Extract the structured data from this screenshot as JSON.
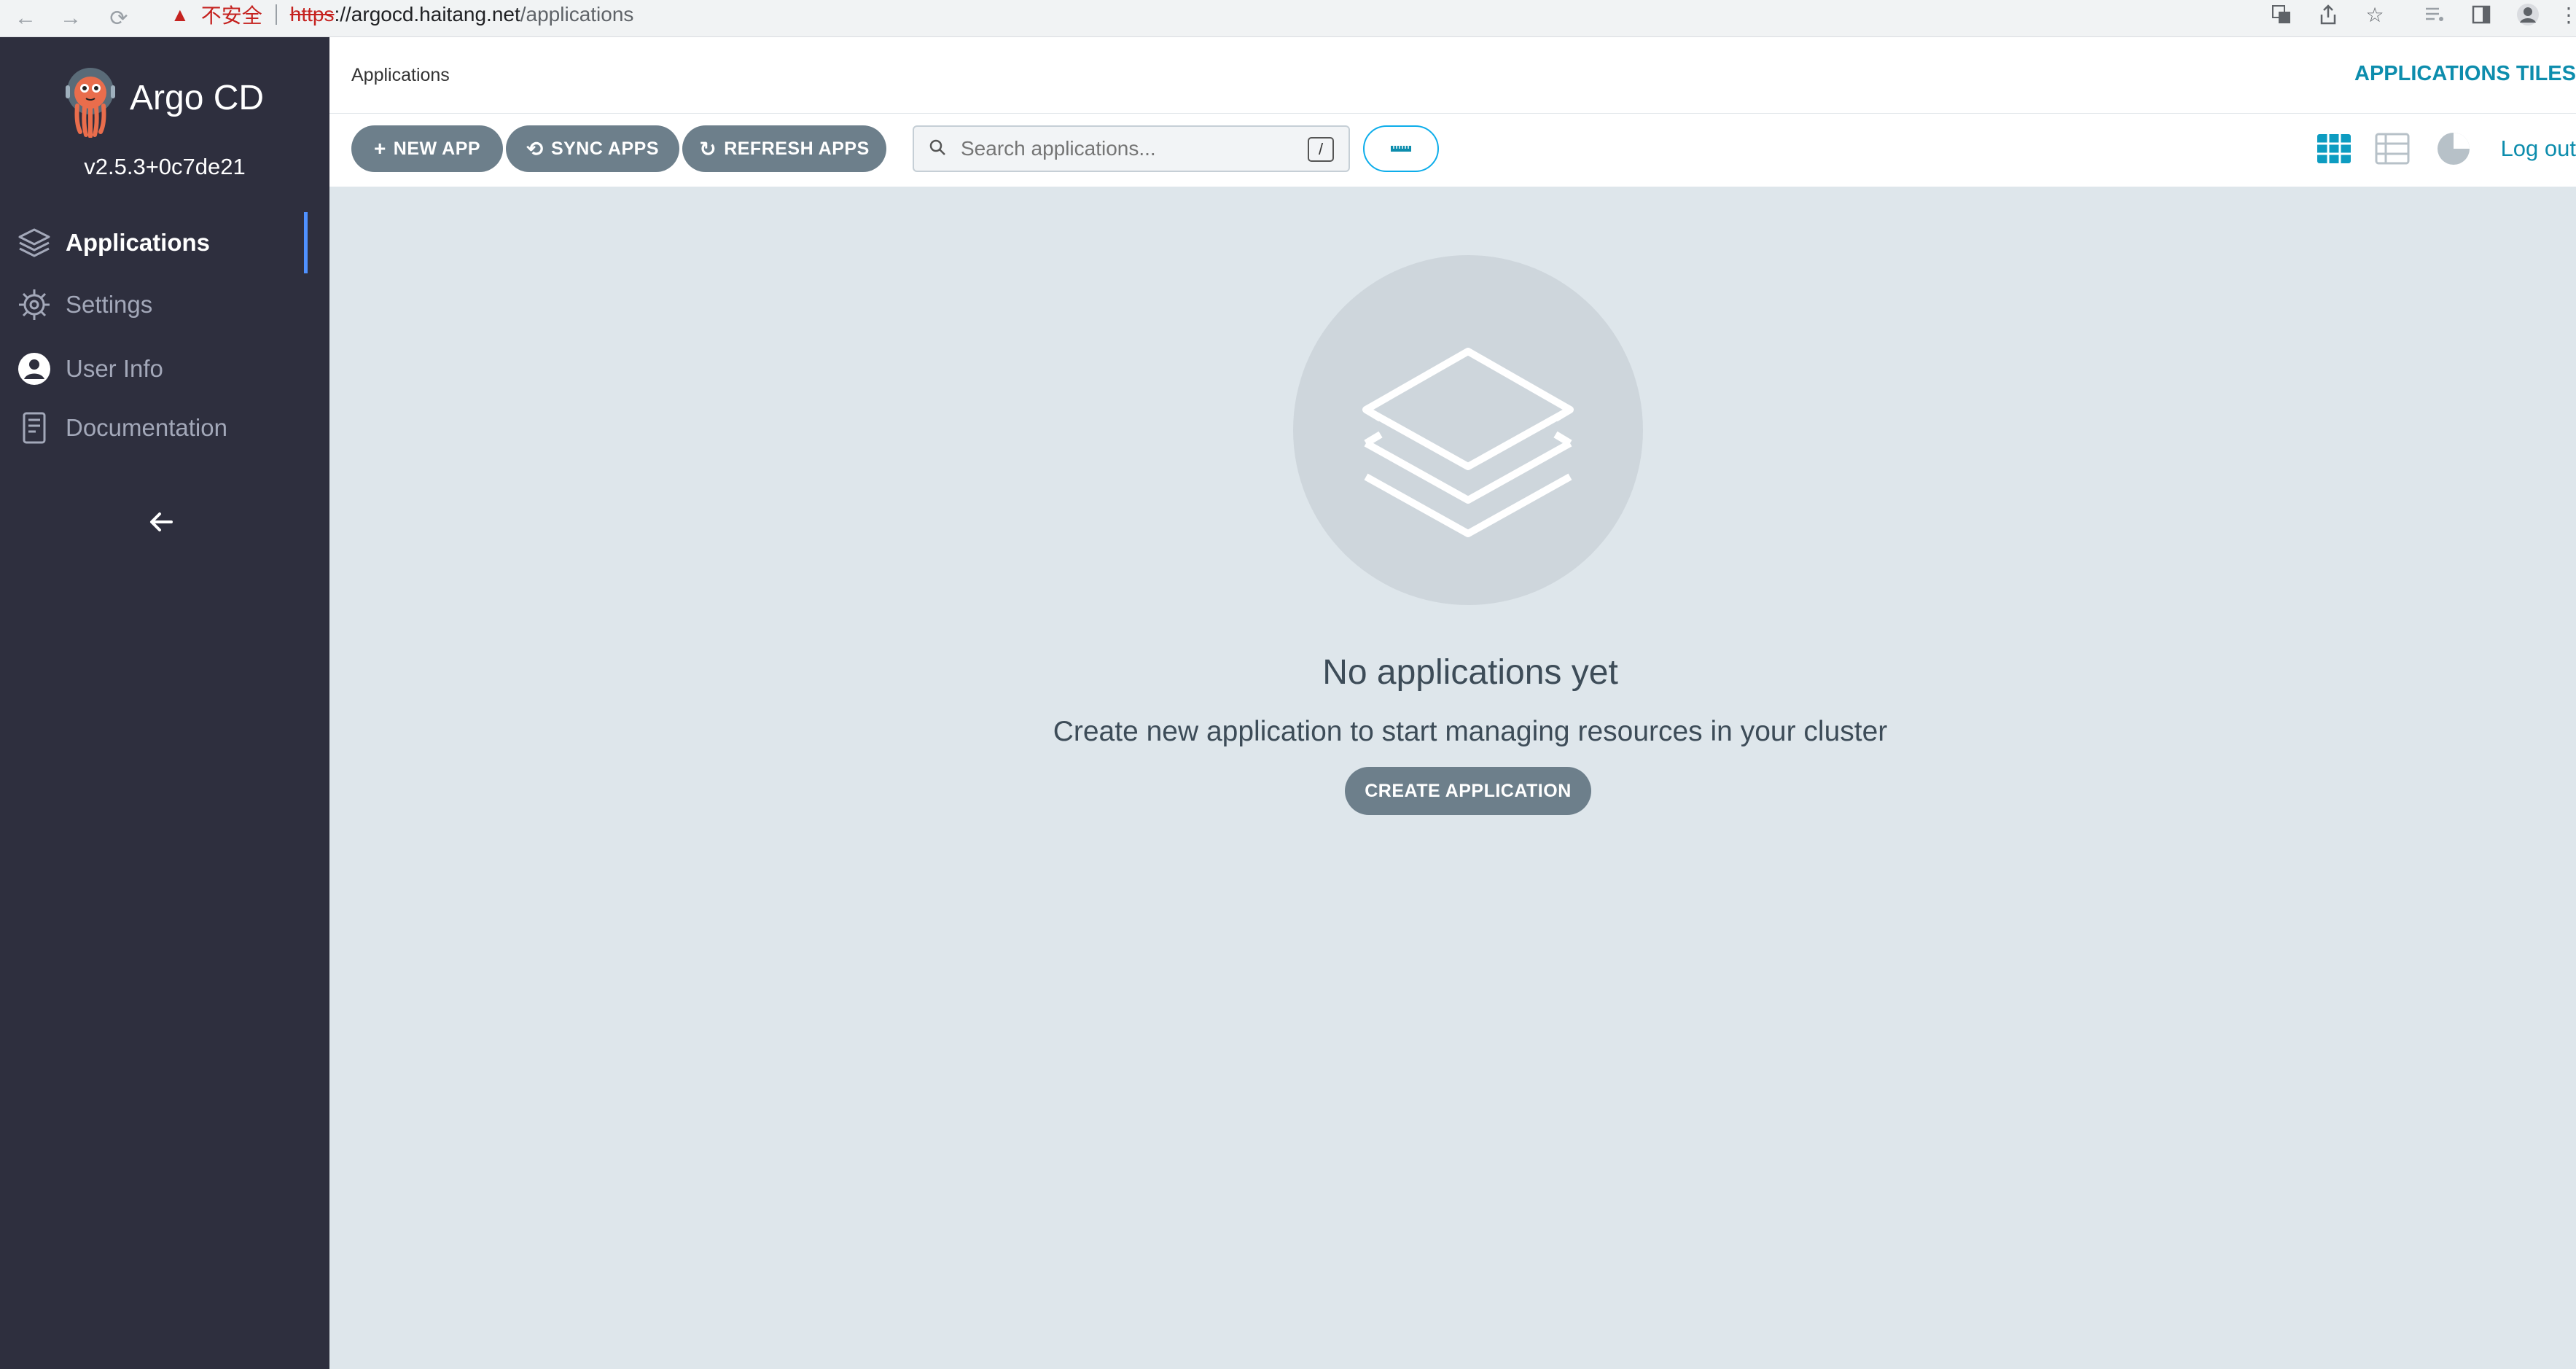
{
  "browser": {
    "insecure_label": "不安全",
    "url_scheme": "https",
    "url_host": "://argocd.haitang.net",
    "url_path": "/applications"
  },
  "sidebar": {
    "brand": "Argo CD",
    "version": "v2.5.3+0c7de21",
    "items": [
      {
        "label": "Applications",
        "icon": "layers-icon",
        "active": true
      },
      {
        "label": "Settings",
        "icon": "gear-icon",
        "active": false
      },
      {
        "label": "User Info",
        "icon": "user-circle-icon",
        "active": false
      },
      {
        "label": "Documentation",
        "icon": "document-icon",
        "active": false
      }
    ],
    "collapse_icon": "arrow-left-icon"
  },
  "header": {
    "breadcrumb": "Applications",
    "title": "APPLICATIONS TILES"
  },
  "toolbar": {
    "new_app": "NEW APP",
    "sync_apps": "SYNC APPS",
    "refresh_apps": "REFRESH APPS",
    "search_placeholder": "Search applications...",
    "search_shortcut": "/",
    "logout": "Log out"
  },
  "empty_state": {
    "title": "No applications yet",
    "subtitle": "Create new application to start managing resources in your cluster",
    "button": "CREATE APPLICATION"
  },
  "colors": {
    "sidebar_bg": "#2e2f3e",
    "main_bg": "#dee6eb",
    "accent": "#0d8dad",
    "button_bg": "#6d7f8b",
    "active_indicator": "#4f91ff"
  }
}
